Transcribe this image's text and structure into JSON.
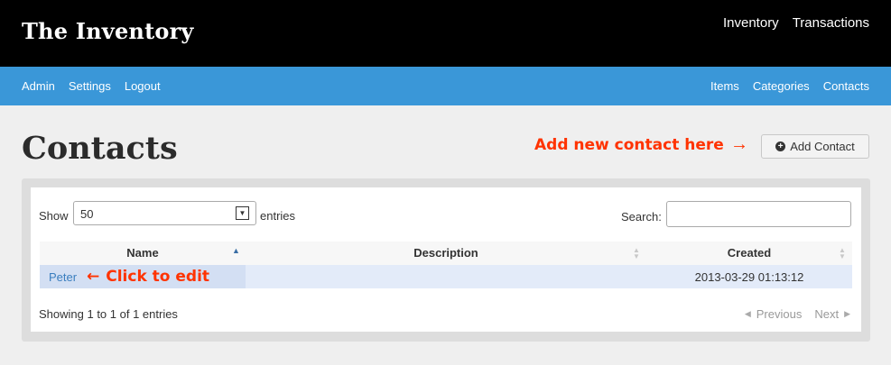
{
  "header": {
    "brand": "The Inventory",
    "nav": [
      "Inventory",
      "Transactions"
    ]
  },
  "subnav": {
    "left": [
      "Admin",
      "Settings",
      "Logout"
    ],
    "right": [
      "Items",
      "Categories",
      "Contacts"
    ]
  },
  "page": {
    "title": "Contacts",
    "add_annotation": "Add new contact here",
    "add_button_label": "Add Contact"
  },
  "table_controls": {
    "show_label": "Show",
    "length_value": "50",
    "entries_label": "entries",
    "search_label": "Search:",
    "search_value": ""
  },
  "table": {
    "columns": [
      "Name",
      "Description",
      "Created"
    ],
    "rows": [
      {
        "name": "Peter",
        "description": "",
        "created": "2013-03-29 01:13:12"
      }
    ],
    "edit_annotation": "Click to edit"
  },
  "footer": {
    "info": "Showing 1 to 1 of 1 entries",
    "previous": "Previous",
    "next": "Next"
  },
  "colors": {
    "topbar": "#000000",
    "subbar": "#3a97d8",
    "annotation": "#ff3300",
    "link": "#3a7ebf"
  }
}
